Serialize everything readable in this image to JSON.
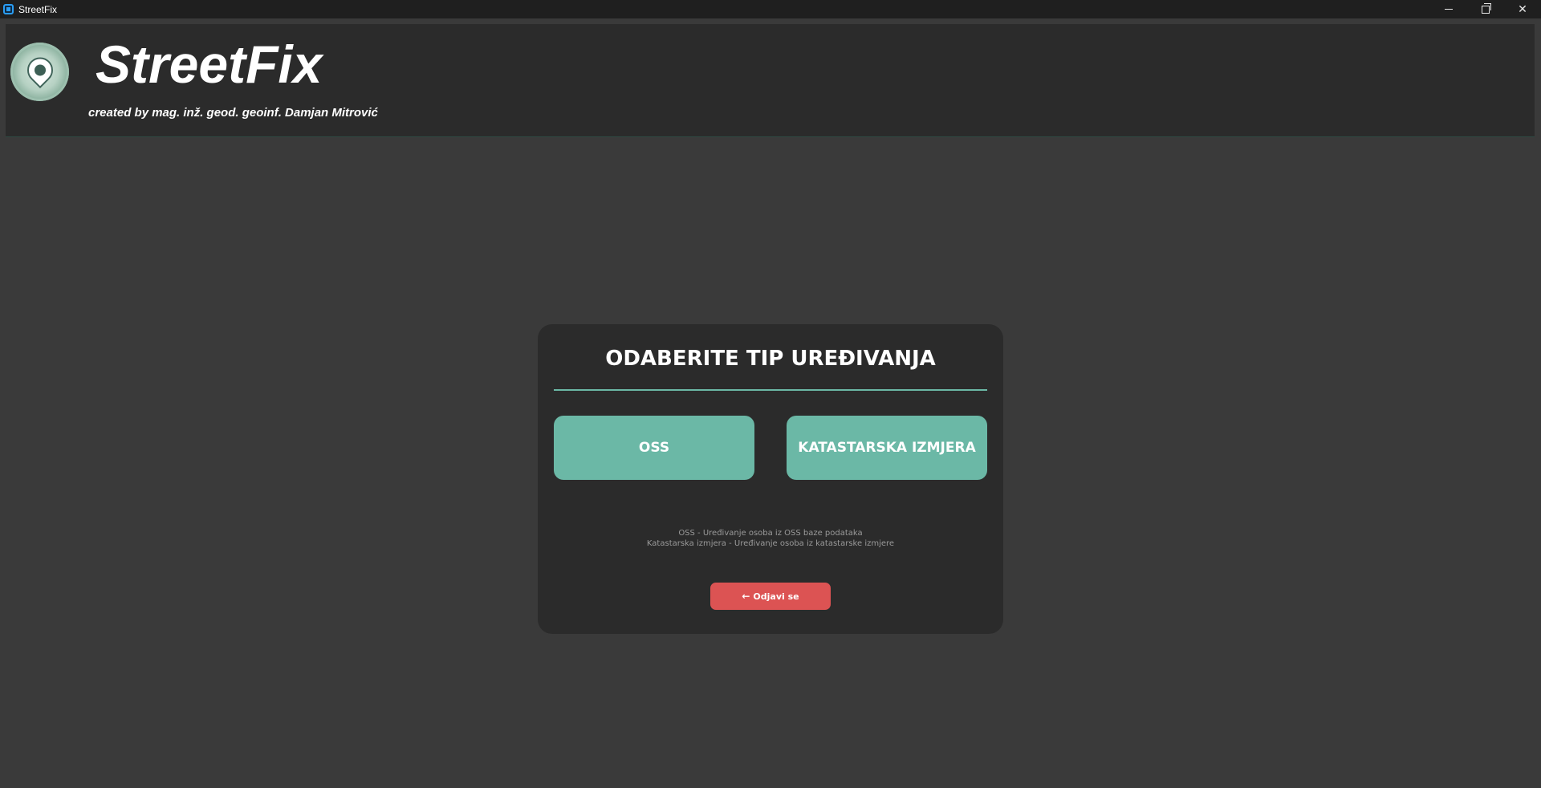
{
  "window": {
    "title": "StreetFix",
    "controls": {
      "minimize_icon": "minimize-icon",
      "maximize_icon": "restore-icon",
      "close_symbol": "✕"
    }
  },
  "header": {
    "app_name": "StreetFix",
    "credit": "created by mag. inž. geod. geoinf. Damjan Mitrović",
    "logo_icon": "map-pin-logo-icon"
  },
  "card": {
    "title": "ODABERITE TIP UREĐIVANJA",
    "buttons": [
      {
        "label": "OSS"
      },
      {
        "label": "KATASTARSKA IZMJERA"
      }
    ],
    "description": [
      "OSS - Uređivanje osoba iz OSS baze podataka",
      "Katastarska izmjera - Uređivanje osoba iz katastarske izmjere"
    ],
    "logout": {
      "arrow": "←",
      "label": "Odjavi se"
    }
  },
  "colors": {
    "background": "#3a3a3a",
    "panel": "#2b2b2b",
    "accent": "#6bb8a6",
    "danger": "#dc5353"
  }
}
